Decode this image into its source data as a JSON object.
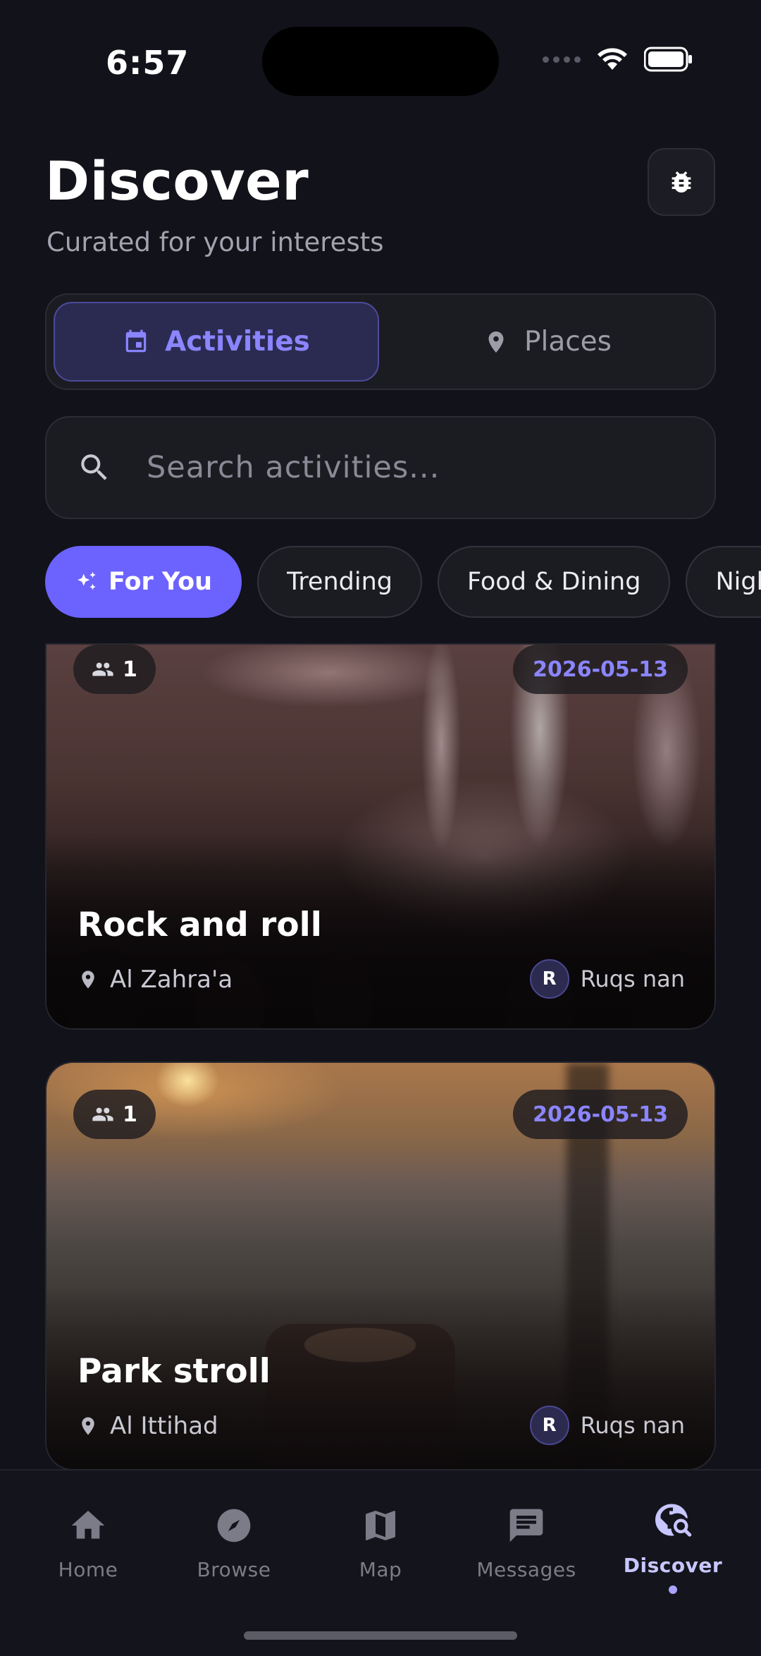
{
  "status_bar": {
    "time": "6:57"
  },
  "header": {
    "title": "Discover",
    "subtitle": "Curated for your interests"
  },
  "segmented": {
    "activities_label": "Activities",
    "places_label": "Places"
  },
  "search": {
    "placeholder": "Search activities..."
  },
  "chips": [
    "For You",
    "Trending",
    "Food & Dining",
    "Nightlife"
  ],
  "cards": [
    {
      "attendees": "1",
      "date": "2026-05-13",
      "title": "Rock and roll",
      "location": "Al Zahra'a",
      "host_initial": "R",
      "host_name": "Ruqs nan"
    },
    {
      "attendees": "1",
      "date": "2026-05-13",
      "title": "Park stroll",
      "location": "Al Ittihad",
      "host_initial": "R",
      "host_name": "Ruqs nan"
    }
  ],
  "nav": {
    "home": "Home",
    "browse": "Browse",
    "map": "Map",
    "messages": "Messages",
    "discover": "Discover"
  },
  "colors": {
    "accent": "#6c63ff",
    "background": "#12121a",
    "date_text": "#8b85ff"
  }
}
